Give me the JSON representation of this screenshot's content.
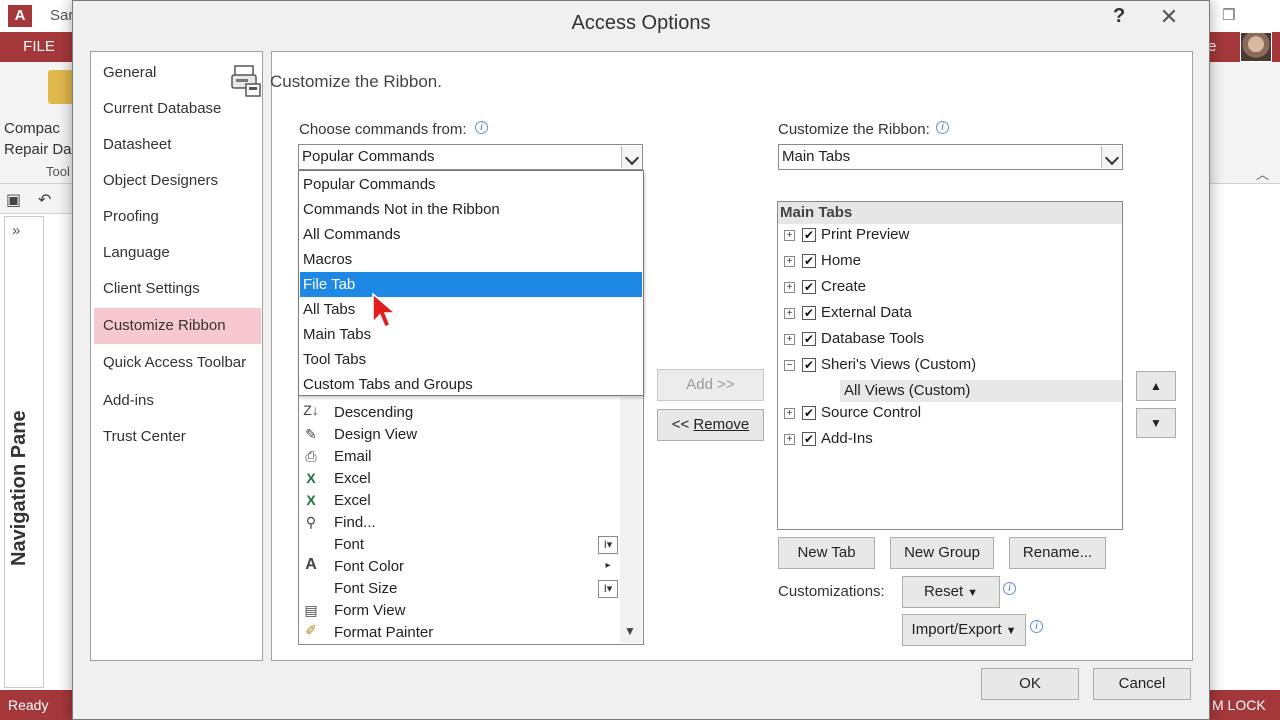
{
  "app": {
    "title_fragment": "Sar",
    "logo_letter": "A",
    "file_tab": "FILE",
    "compact_label_1": "Compac",
    "compact_label_2": "Repair Da",
    "tools_label": "Tool",
    "user_fragment": "e",
    "nav_pane_label": "Navigation Pane",
    "status_ready": "Ready",
    "status_numlock": "M LOCK",
    "restore_glyph": "❐"
  },
  "dialog": {
    "title": "Access Options",
    "help": "?",
    "close": "✕",
    "categories": [
      {
        "label": "General"
      },
      {
        "label": "Current Database"
      },
      {
        "label": "Datasheet"
      },
      {
        "label": "Object Designers"
      },
      {
        "label": "Proofing"
      },
      {
        "label": "Language"
      },
      {
        "label": "Client Settings"
      },
      {
        "label": "Customize Ribbon"
      },
      {
        "label": "Quick Access Toolbar"
      },
      {
        "label": "Add-ins"
      },
      {
        "label": "Trust Center"
      }
    ],
    "selected_category": "Customize Ribbon",
    "section_title": "Customize the Ribbon.",
    "choose_label": "Choose commands from:",
    "choose_value": "Popular Commands",
    "customize_label": "Customize the Ribbon:",
    "customize_value": "Main Tabs",
    "dropdown_options": [
      "Popular Commands",
      "Commands Not in the Ribbon",
      "All Commands",
      "Macros",
      "File Tab",
      "All Tabs",
      "Main Tabs",
      "Tool Tabs",
      "Custom Tabs and Groups"
    ],
    "highlighted_option": "File Tab",
    "commands": [
      {
        "label": "Descending",
        "icon": "sort-descending-icon",
        "glyph": "Z↓"
      },
      {
        "label": "Design View",
        "icon": "design-view-icon",
        "glyph": "✎"
      },
      {
        "label": "Email",
        "icon": "attachment-icon",
        "glyph": "⎙"
      },
      {
        "label": "Excel",
        "icon": "excel-icon",
        "glyph": "X"
      },
      {
        "label": "Excel",
        "icon": "excel-icon",
        "glyph": "X"
      },
      {
        "label": "Find...",
        "icon": "binoculars-icon",
        "glyph": "⚲"
      },
      {
        "label": "Font",
        "icon": "font-icon",
        "glyph": ""
      },
      {
        "label": "Font Color",
        "icon": "font-color-icon",
        "glyph": "A"
      },
      {
        "label": "Font Size",
        "icon": "font-size-icon",
        "glyph": ""
      },
      {
        "label": "Form View",
        "icon": "form-view-icon",
        "glyph": "▤"
      },
      {
        "label": "Format Painter",
        "icon": "format-painter-icon",
        "glyph": "✐"
      }
    ],
    "add_button": "Add >>",
    "remove_button_prefix": "<< ",
    "remove_button_text": "Remove",
    "tree_header": "Main Tabs",
    "tree_items": [
      {
        "label": "Print Preview",
        "expander": "+"
      },
      {
        "label": "Home",
        "expander": "+"
      },
      {
        "label": "Create",
        "expander": "+"
      },
      {
        "label": "External Data",
        "expander": "+"
      },
      {
        "label": "Database Tools",
        "expander": "+"
      },
      {
        "label": "Sheri's Views (Custom)",
        "expander": "−"
      },
      {
        "label": "Source Control",
        "expander": "+"
      },
      {
        "label": "Add-Ins",
        "expander": "+"
      }
    ],
    "tree_subitem": "All Views (Custom)",
    "new_tab": "New Tab",
    "new_group": "New Group",
    "rename": "Rename...",
    "customizations_label": "Customizations:",
    "reset": "Reset",
    "import_export": "Import/Export",
    "ok": "OK",
    "cancel": "Cancel"
  },
  "colors": {
    "access_brand": "#a4373a",
    "selected_category_bg": "#f7c8cf",
    "highlight": "#1e88e5"
  }
}
